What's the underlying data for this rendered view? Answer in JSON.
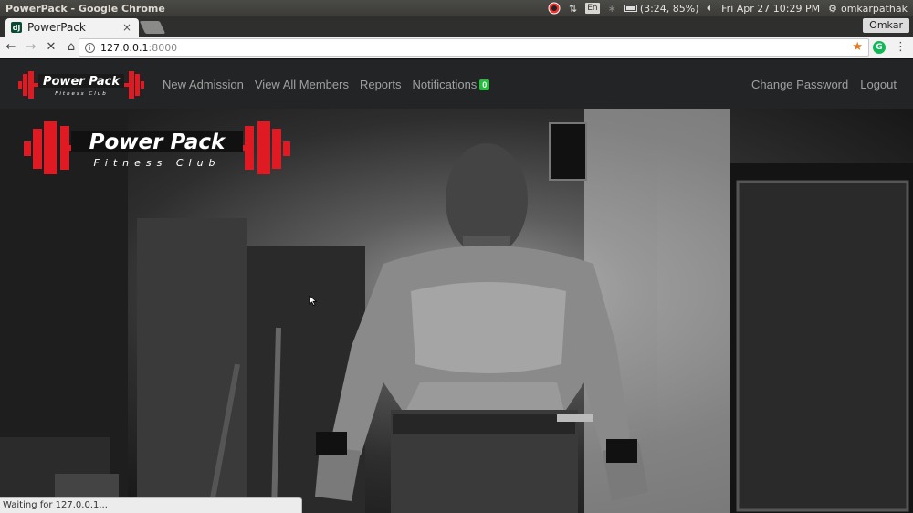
{
  "os_bar": {
    "window_title": "PowerPack - Google Chrome",
    "keyboard_layout": "En",
    "battery": "(3:24, 85%)",
    "datetime": "Fri Apr 27 10:29 PM",
    "username": "omkarpathak"
  },
  "browser": {
    "tab_title": "PowerPack",
    "profile_name": "Omkar",
    "url_host": "127.0.0.1",
    "url_port": ":8000",
    "status_text": "Waiting for 127.0.0.1..."
  },
  "navbar": {
    "brand_title": "Power Pack",
    "brand_subtitle": "Fitness Club",
    "links": {
      "new_admission": "New Admission",
      "view_members": "View All Members",
      "reports": "Reports",
      "notifications": "Notifications"
    },
    "notification_count": "0",
    "change_password": "Change Password",
    "logout": "Logout"
  },
  "hero": {
    "logo_title": "Power Pack",
    "logo_subtitle": "Fitness Club"
  },
  "colors": {
    "navbar_bg": "#222426",
    "badge_green": "#22c03a",
    "logo_red": "#e01a22",
    "star_orange": "#e8791e"
  },
  "icons": [
    "back-icon",
    "forward-icon",
    "reload-icon",
    "home-icon",
    "info-icon",
    "star-icon",
    "extension-icon",
    "menu-icon",
    "tab-close-icon",
    "volume-icon",
    "battery-icon",
    "settings-gear-icon",
    "network-icon",
    "bluetooth-icon"
  ]
}
